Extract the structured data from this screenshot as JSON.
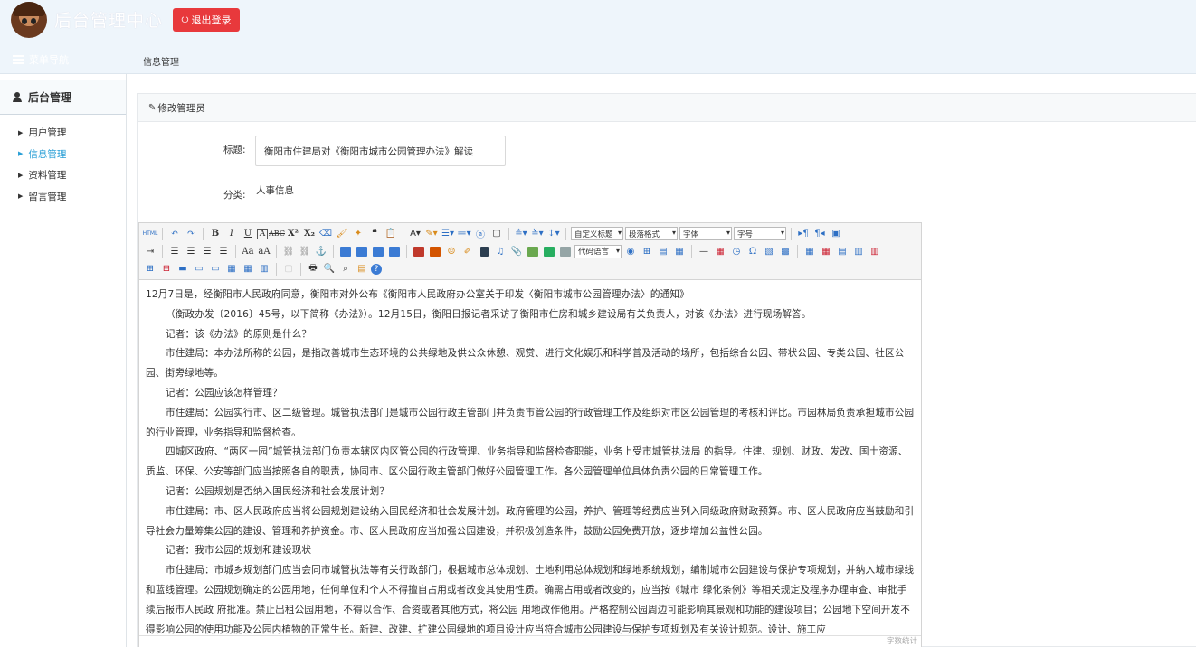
{
  "header": {
    "brand": "后台管理中心",
    "logout_label": "退出登录"
  },
  "subhead": {
    "menu_toggle_label": "菜单导航",
    "breadcrumb": "信息管理"
  },
  "sidebar": {
    "section_title": "后台管理",
    "items": [
      {
        "label": "用户管理",
        "active": false
      },
      {
        "label": "信息管理",
        "active": true
      },
      {
        "label": "资料管理",
        "active": false
      },
      {
        "label": "留言管理",
        "active": false
      }
    ]
  },
  "panel": {
    "title": "修改管理员"
  },
  "form": {
    "title_label": "标题:",
    "title_value": "衡阳市住建局对《衡阳市城市公园管理办法》解读",
    "category_label": "分类:",
    "category_value": "人事信息"
  },
  "editor": {
    "selects": {
      "custom_title": "自定义标题",
      "paragraph": "段落格式",
      "font_family": "字体",
      "font_size": "字号",
      "code_lang": "代码语言"
    },
    "status_word_count": "字数统计",
    "paragraphs": [
      {
        "text": "12月7日是，经衡阳市人民政府同意，衡阳市对外公布《衡阳市人民政府办公室关于印发〈衡阳市城市公园管理办法〉的通知》",
        "indent": false
      },
      {
        "text": "（衡政办发〔2016〕45号，以下简称《办法》）。12月15日，衡阳日报记者采访了衡阳市住房和城乡建设局有关负责人，对该《办法》进行现场解答。",
        "indent": true
      },
      {
        "text": "记者：该《办法》的原则是什么？",
        "indent": true
      },
      {
        "text": "市住建局：本办法所称的公园，是指改善城市生态环境的公共绿地及供公众休憩、观赏、进行文化娱乐和科学普及活动的场所，包括综合公园、带状公园、专类公园、社区公园、街旁绿地等。",
        "indent": true
      },
      {
        "text": "记者：公园应该怎样管理？",
        "indent": true
      },
      {
        "text": "市住建局：公园实行市、区二级管理。城管执法部门是城市公园行政主管部门并负责市管公园的行政管理工作及组织对市区公园管理的考核和评比。市园林局负责承担城市公园的行业管理，业务指导和监督检查。",
        "indent": true
      },
      {
        "text": "四城区政府、“两区一园”城管执法部门负责本辖区内区管公园的行政管理、业务指导和监督检查职能，业务上受市城管执法局 的指导。住建、规划、财政、发改、国土资源、质监、环保、公安等部门应当按照各自的职责，协同市、区公园行政主管部门做好公园管理工作。各公园管理单位具体负责公园的日常管理工作。",
        "indent": true
      },
      {
        "text": "记者：公园规划是否纳入国民经济和社会发展计划？",
        "indent": true
      },
      {
        "text": "市住建局：市、区人民政府应当将公园规划建设纳入国民经济和社会发展计划。政府管理的公园，养护、管理等经费应当列入同级政府财政预算。市、区人民政府应当鼓励和引导社会力量筹集公园的建设、管理和养护资金。市、区人民政府应当加强公园建设，并积极创造条件，鼓励公园免费开放，逐步增加公益性公园。",
        "indent": true
      },
      {
        "text": "记者：我市公园的规划和建设现状",
        "indent": true
      },
      {
        "text": "市住建局：市城乡规划部门应当会同市城管执法等有关行政部门，根据城市总体规划、土地利用总体规划和绿地系统规划，编制城市公园建设与保护专项规划，并纳入城市绿线和蓝线管理。公园规划确定的公园用地，任何单位和个人不得擅自占用或者改变其使用性质。确需占用或者改变的，应当按《城市 绿化条例》等相关规定及程序办理审查、审批手续后报市人民政 府批准。禁止出租公园用地，不得以合作、合资或者其他方式，将公园 用地改作他用。严格控制公园周边可能影响其景观和功能的建设项目；公园地下空间开发不得影响公园的使用功能及公园内植物的正常生长。新建、改建、扩建公园绿地的项目设计应当符合城市公园建设与保护专项规划及有关设计规范。设计、施工应",
        "indent": true
      }
    ]
  }
}
